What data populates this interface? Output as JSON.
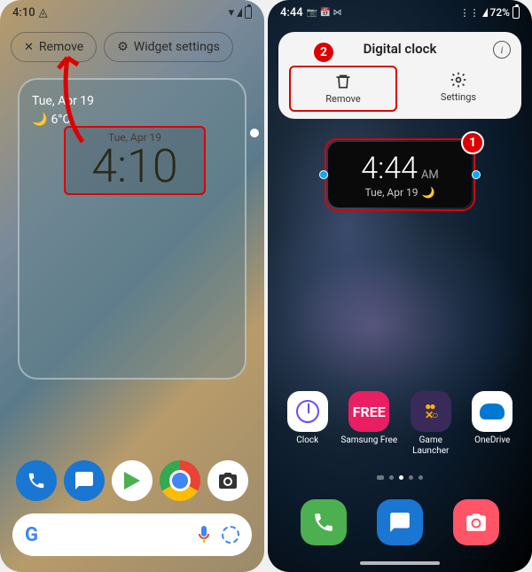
{
  "left": {
    "status": {
      "time": "4:10",
      "icons": [
        "face-unlock-icon"
      ]
    },
    "remove_pill": {
      "label": "Remove"
    },
    "settings_pill": {
      "label": "Widget settings"
    },
    "weather": {
      "date": "Tue, Apr 19",
      "temp": "6°C",
      "cond": "🌙"
    },
    "clock_widget": {
      "date": "Tue, Apr 19",
      "time": "4:10"
    },
    "dock": [
      "Phone",
      "Messages",
      "Play Store",
      "Chrome",
      "Camera"
    ]
  },
  "right": {
    "status": {
      "time": "4:44",
      "indicators": "📷 📅 ⋈",
      "batt": "72%"
    },
    "popup": {
      "title": "Digital clock",
      "remove": "Remove",
      "settings": "Settings"
    },
    "clock_widget": {
      "time": "4:44",
      "ampm": "AM",
      "date": "Tue, Apr 19",
      "moon": "🌙"
    },
    "badges": {
      "one": "1",
      "two": "2"
    },
    "apps": [
      {
        "label": "Clock"
      },
      {
        "label": "Samsung Free",
        "text": "FREE"
      },
      {
        "label": "Game Launcher",
        "text": "••\n✕●"
      },
      {
        "label": "OneDrive"
      }
    ],
    "dock": [
      "Phone",
      "Messages",
      "Camera"
    ]
  }
}
